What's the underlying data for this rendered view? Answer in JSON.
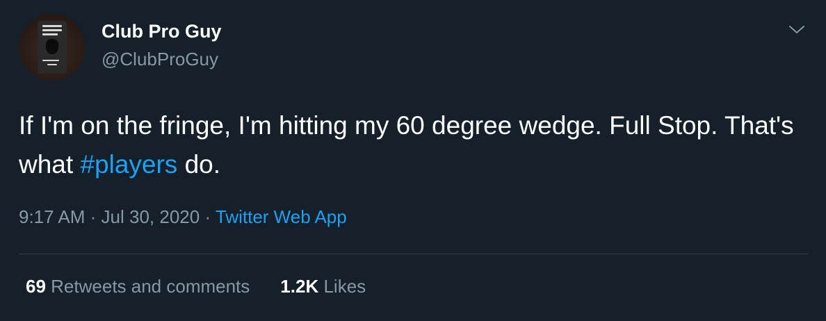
{
  "author": {
    "display_name": "Club Pro Guy",
    "handle": "@ClubProGuy",
    "avatar_icon": "profile-avatar"
  },
  "tweet": {
    "text_before_hashtag": "If I'm on the fringe, I'm hitting my 60 degree wedge. Full Stop. That's what ",
    "hashtag": "#players",
    "text_after_hashtag": " do."
  },
  "meta": {
    "time": "9:17 AM",
    "separator": "·",
    "date": "Jul 30, 2020",
    "source": "Twitter Web App"
  },
  "stats": {
    "retweets_count": "69",
    "retweets_label": "Retweets and comments",
    "likes_count": "1.2K",
    "likes_label": "Likes"
  },
  "menu": {
    "icon": "chevron-down-icon"
  },
  "colors": {
    "background": "#15202b",
    "primary_text": "#ffffff",
    "secondary_text": "#8899a6",
    "link": "#1da1f2",
    "divider": "#38444d"
  }
}
